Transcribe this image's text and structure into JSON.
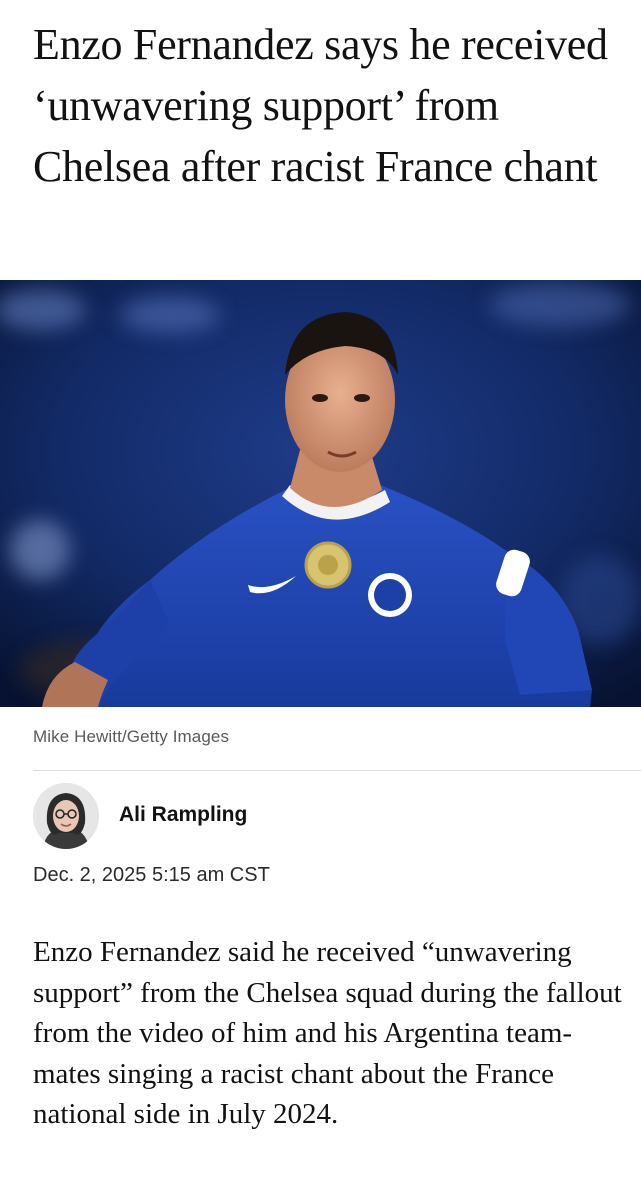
{
  "article": {
    "headline": "Enzo Fernandez says he received ‘unwavering support’ from Chelsea after racist France chant",
    "hero_image": {
      "description_icon": "footballer-photo",
      "caption": "Mike Hewitt/Getty Images"
    },
    "byline": {
      "author": "Ali Rampling",
      "avatar_icon": "author-avatar",
      "timestamp": "Dec. 2, 2025 5:15 am CST"
    },
    "lede": "Enzo Fernandez said he received “unwavering support” from the Chelsea squad during the fallout from the video of him and his Argentina team-mates singing a racist chant about the France national side in July 2024."
  },
  "colors": {
    "text": "#121212",
    "caption": "#5a5a5a",
    "kit_blue": "#1d3fa6"
  }
}
